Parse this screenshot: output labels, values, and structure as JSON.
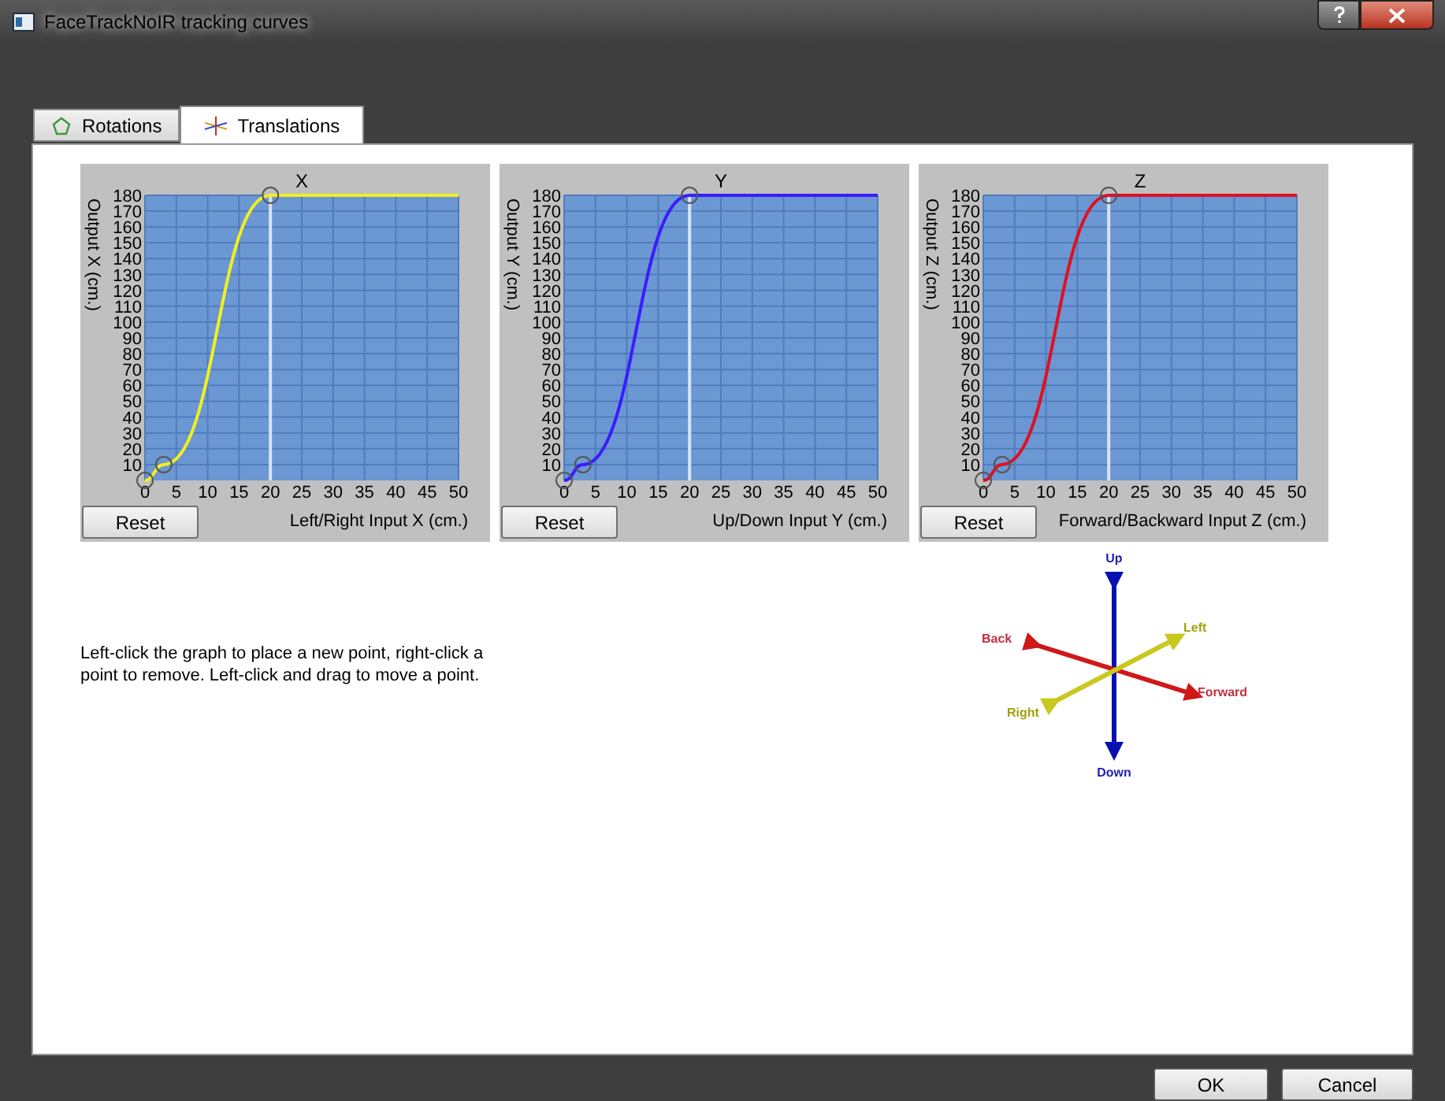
{
  "window": {
    "title": "FaceTrackNoIR tracking curves"
  },
  "tabs": [
    {
      "label": "Rotations",
      "kind": "rotations",
      "selected": false
    },
    {
      "label": "Translations",
      "kind": "translations",
      "selected": true
    }
  ],
  "charts": [
    {
      "reset_label": "Reset",
      "chart_data": {
        "type": "line",
        "title": "X",
        "grid": true,
        "ref_lines": [
          {
            "axis": "x",
            "value": 20
          }
        ],
        "xlabel": "Left/Right Input X (cm.)",
        "ylabel": "Output X (cm.)",
        "x": [
          0,
          3,
          20,
          50
        ],
        "series": [
          {
            "color": "#f0f020",
            "values": [
              0,
              10,
              180,
              180
            ]
          }
        ],
        "xlim": [
          0,
          50
        ],
        "ylim": [
          0,
          180
        ],
        "xticks": [
          0,
          5,
          10,
          15,
          20,
          25,
          30,
          35,
          40,
          45,
          50
        ],
        "yticks": [
          10,
          20,
          30,
          40,
          50,
          60,
          70,
          80,
          90,
          100,
          110,
          120,
          130,
          140,
          150,
          160,
          170,
          180
        ]
      }
    },
    {
      "reset_label": "Reset",
      "chart_data": {
        "type": "line",
        "title": "Y",
        "grid": true,
        "ref_lines": [
          {
            "axis": "x",
            "value": 20
          }
        ],
        "xlabel": "Up/Down Input Y (cm.)",
        "ylabel": "Output Y (cm.)",
        "x": [
          0,
          3,
          20,
          50
        ],
        "series": [
          {
            "color": "#3a1cff",
            "values": [
              0,
              10,
              180,
              180
            ]
          }
        ],
        "xlim": [
          0,
          50
        ],
        "ylim": [
          0,
          180
        ],
        "xticks": [
          0,
          5,
          10,
          15,
          20,
          25,
          30,
          35,
          40,
          45,
          50
        ],
        "yticks": [
          10,
          20,
          30,
          40,
          50,
          60,
          70,
          80,
          90,
          100,
          110,
          120,
          130,
          140,
          150,
          160,
          170,
          180
        ]
      }
    },
    {
      "reset_label": "Reset",
      "chart_data": {
        "type": "line",
        "title": "Z",
        "grid": true,
        "ref_lines": [
          {
            "axis": "x",
            "value": 20
          }
        ],
        "xlabel": "Forward/Backward Input Z (cm.)",
        "ylabel": "Output Z (cm.)",
        "x": [
          0,
          3,
          20,
          50
        ],
        "series": [
          {
            "color": "#e01020",
            "values": [
              0,
              10,
              180,
              180
            ]
          }
        ],
        "xlim": [
          0,
          50
        ],
        "ylim": [
          0,
          180
        ],
        "xticks": [
          0,
          5,
          10,
          15,
          20,
          25,
          30,
          35,
          40,
          45,
          50
        ],
        "yticks": [
          10,
          20,
          30,
          40,
          50,
          60,
          70,
          80,
          90,
          100,
          110,
          120,
          130,
          140,
          150,
          160,
          170,
          180
        ]
      }
    }
  ],
  "help_text": "Left-click the graph to place a new point, right-click a point to remove. Left-click and drag to move a point.",
  "axes_figure": {
    "labels": [
      {
        "kind": "up",
        "text": "Up"
      },
      {
        "kind": "back",
        "text": "Back"
      },
      {
        "kind": "left",
        "text": "Left"
      },
      {
        "kind": "right",
        "text": "Right"
      },
      {
        "kind": "forward",
        "text": "Forward"
      },
      {
        "kind": "down",
        "text": "Down"
      }
    ]
  },
  "buttons": [
    {
      "label": "OK"
    },
    {
      "label": "Cancel"
    }
  ]
}
